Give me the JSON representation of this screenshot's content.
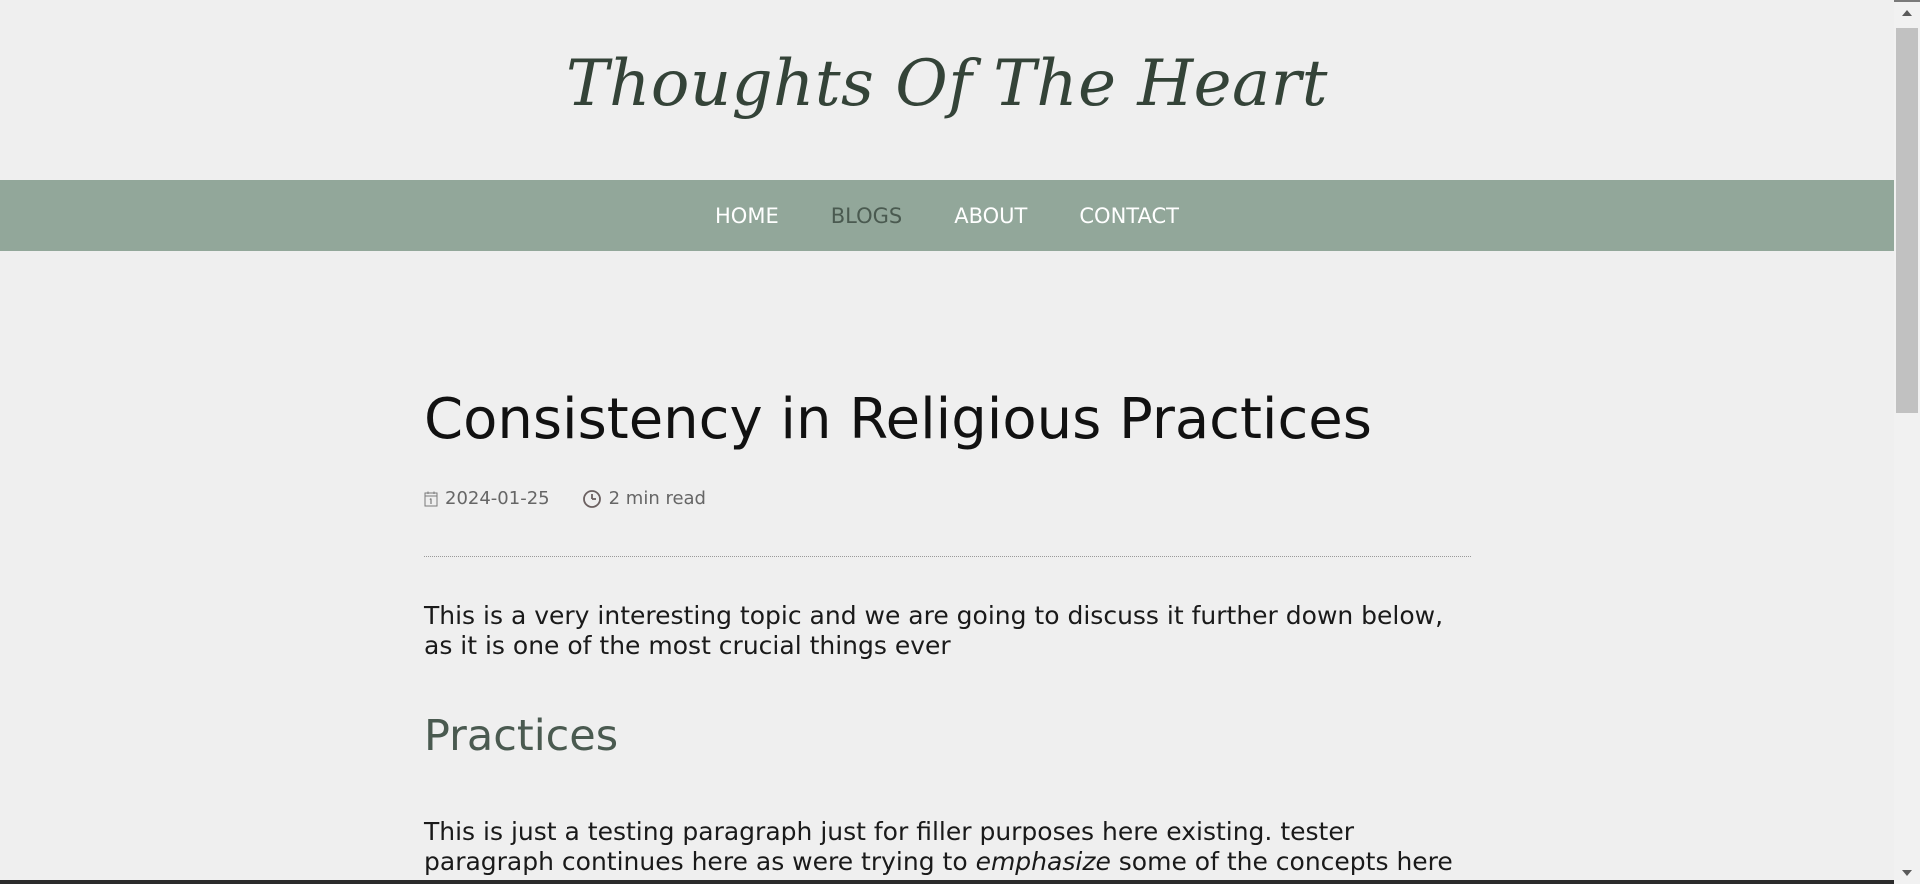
{
  "site": {
    "title": "Thoughts Of The Heart"
  },
  "nav": {
    "items": [
      {
        "label": "HOME",
        "active": false
      },
      {
        "label": "BLOGS",
        "active": true
      },
      {
        "label": "ABOUT",
        "active": false
      },
      {
        "label": "CONTACT",
        "active": false
      }
    ]
  },
  "post": {
    "title": "Consistency in Religious Practices",
    "date": "2024-01-25",
    "date_icon": "calendar-icon",
    "read_time": "2 min read",
    "read_time_icon": "clock-icon",
    "intro": "This is a very interesting topic and we are going to discuss it further down below, as it is one of the most crucial things ever",
    "section_heading": "Practices",
    "body_before_em": "This is just a testing paragraph just for filler purposes here existing. tester paragraph continues here as were trying to ",
    "body_em": "emphasize",
    "body_after_em": " some of the concepts here we can also make"
  },
  "colors": {
    "background": "#efefef",
    "nav_background": "#92a79a",
    "nav_text": "#ffffff",
    "nav_active_text": "#4a5a50",
    "title_color": "#344338",
    "heading_accent": "#4a5a50"
  }
}
